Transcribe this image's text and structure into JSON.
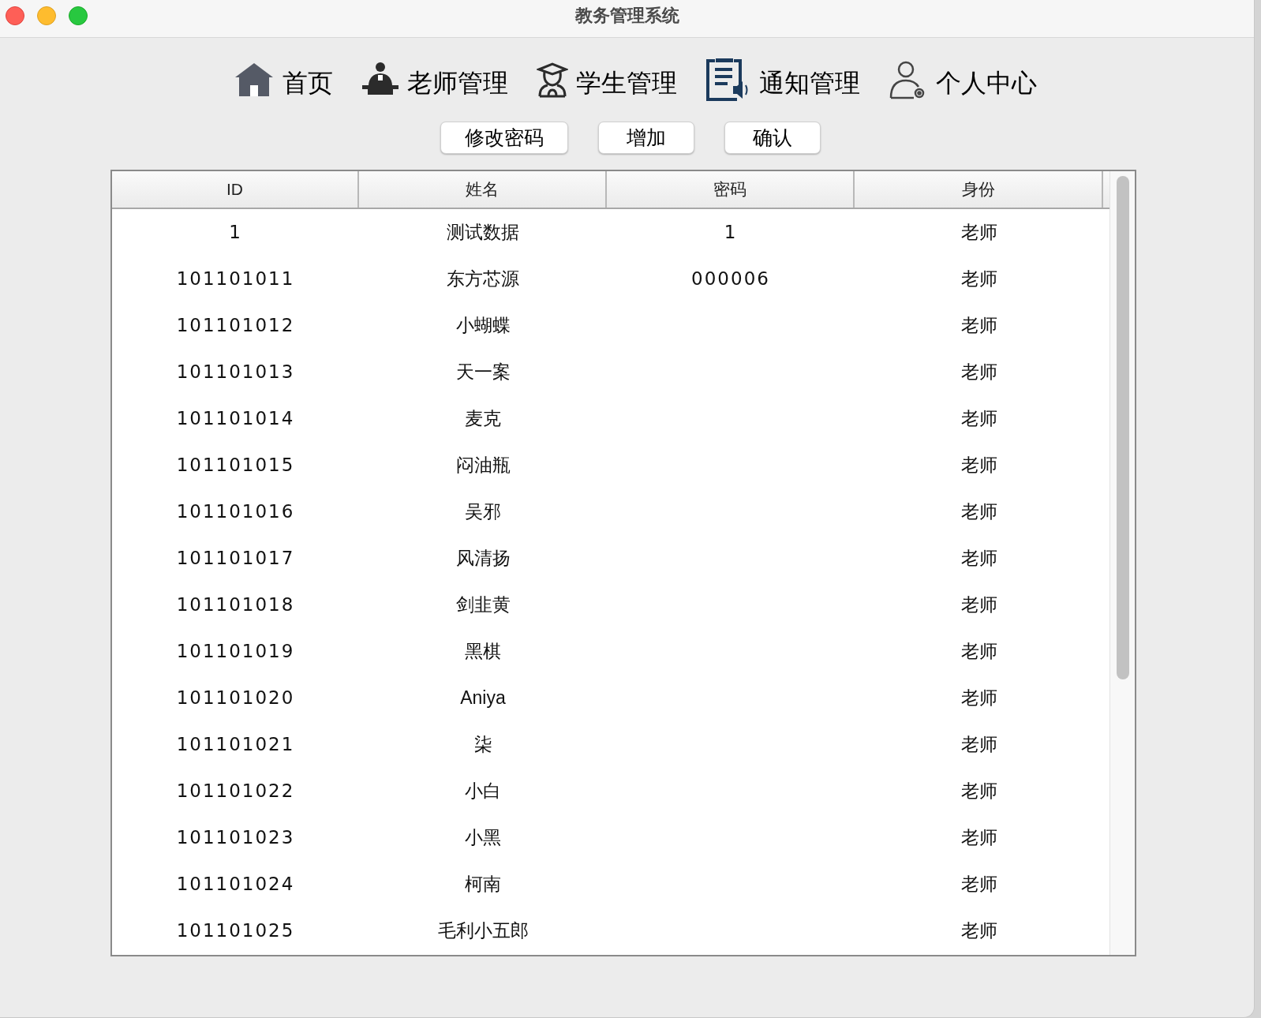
{
  "window": {
    "title": "教务管理系统"
  },
  "nav": [
    {
      "label": "首页",
      "kind": "home"
    },
    {
      "label": "老师管理",
      "kind": "teacher"
    },
    {
      "label": "学生管理",
      "kind": "student"
    },
    {
      "label": "通知管理",
      "kind": "notice"
    },
    {
      "label": "个人中心",
      "kind": "profile"
    }
  ],
  "buttons": [
    "修改密码",
    "增加",
    "确认"
  ],
  "table": {
    "columns": [
      "ID",
      "姓名",
      "密码",
      "身份"
    ],
    "rows": [
      {
        "id": "1",
        "name": "测试数据",
        "password": "1",
        "role": "老师"
      },
      {
        "id": "101101011",
        "name": "东方芯源",
        "password": "000006",
        "role": "老师"
      },
      {
        "id": "101101012",
        "name": "小蝴蝶",
        "role": "老师"
      },
      {
        "id": "101101013",
        "name": "天一案",
        "role": "老师"
      },
      {
        "id": "101101014",
        "name": "麦克",
        "role": "老师"
      },
      {
        "id": "101101015",
        "name": "闷油瓶",
        "role": "老师"
      },
      {
        "id": "101101016",
        "name": "吴邪",
        "role": "老师"
      },
      {
        "id": "101101017",
        "name": "风清扬",
        "role": "老师"
      },
      {
        "id": "101101018",
        "name": "剑韭黄",
        "role": "老师"
      },
      {
        "id": "101101019",
        "name": "黑棋",
        "role": "老师"
      },
      {
        "id": "101101020",
        "name": "Aniya",
        "role": "老师"
      },
      {
        "id": "101101021",
        "name": "柒",
        "role": "老师"
      },
      {
        "id": "101101022",
        "name": "小白",
        "role": "老师"
      },
      {
        "id": "101101023",
        "name": "小黑",
        "role": "老师"
      },
      {
        "id": "101101024",
        "name": "柯南",
        "role": "老师"
      },
      {
        "id": "101101025",
        "name": "毛利小五郎",
        "role": "老师"
      }
    ]
  }
}
